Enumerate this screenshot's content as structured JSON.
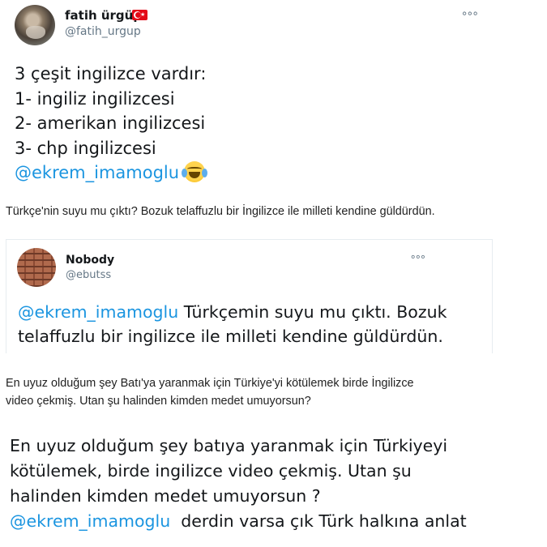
{
  "main_tweet": {
    "display_name": "fatih ürgüp",
    "handle": "@fatih_urgup",
    "flag": "turkey-flag-icon",
    "more_icon": "more-icon",
    "lines": [
      "3 çeşit ingilizce vardır:",
      "1- ingiliz ingilizcesi",
      "2- amerikan ingilizcesi",
      "3- chp ingilizcesi"
    ],
    "mention": "@ekrem_imamoglu",
    "emoji": "face-with-tears-of-joy-icon"
  },
  "caption_1": "Türkçe'nin suyu mu çıktı? Bozuk telaffuzlu bir İngilizce ile milleti kendine güldürdün.",
  "quote_tweet": {
    "display_name": "Nobody",
    "handle": "@ebutss",
    "mention": "@ekrem_imamoglu",
    "line1_rest": " Türkçemin suyu mu çıktı. Bozuk",
    "line2": "telaffuzlu bir ingilizce ile milleti kendine güldürdün."
  },
  "caption_2": {
    "line1": "En uyuz olduğum şey Batı'ya yaranmak için Türkiye'yi kötülemek birde İngilizce",
    "line2": "video çekmiş. Utan şu halinden kimden medet umuyorsun?"
  },
  "bottom_comment": {
    "lines": [
      "En uyuz olduğum şey batıya yaranmak için Türkiyeyi",
      "kötülemek, birde ingilizce video çekmiş. Utan şu",
      "halinden kimden medet umuyorsun ?"
    ],
    "mention": "@ekrem_imamoglu",
    "mention_rest": "  derdin varsa çık Türk halkına anlat"
  },
  "colors": {
    "mention": "#1b95e0",
    "handle": "#657786",
    "text": "#14171a"
  }
}
